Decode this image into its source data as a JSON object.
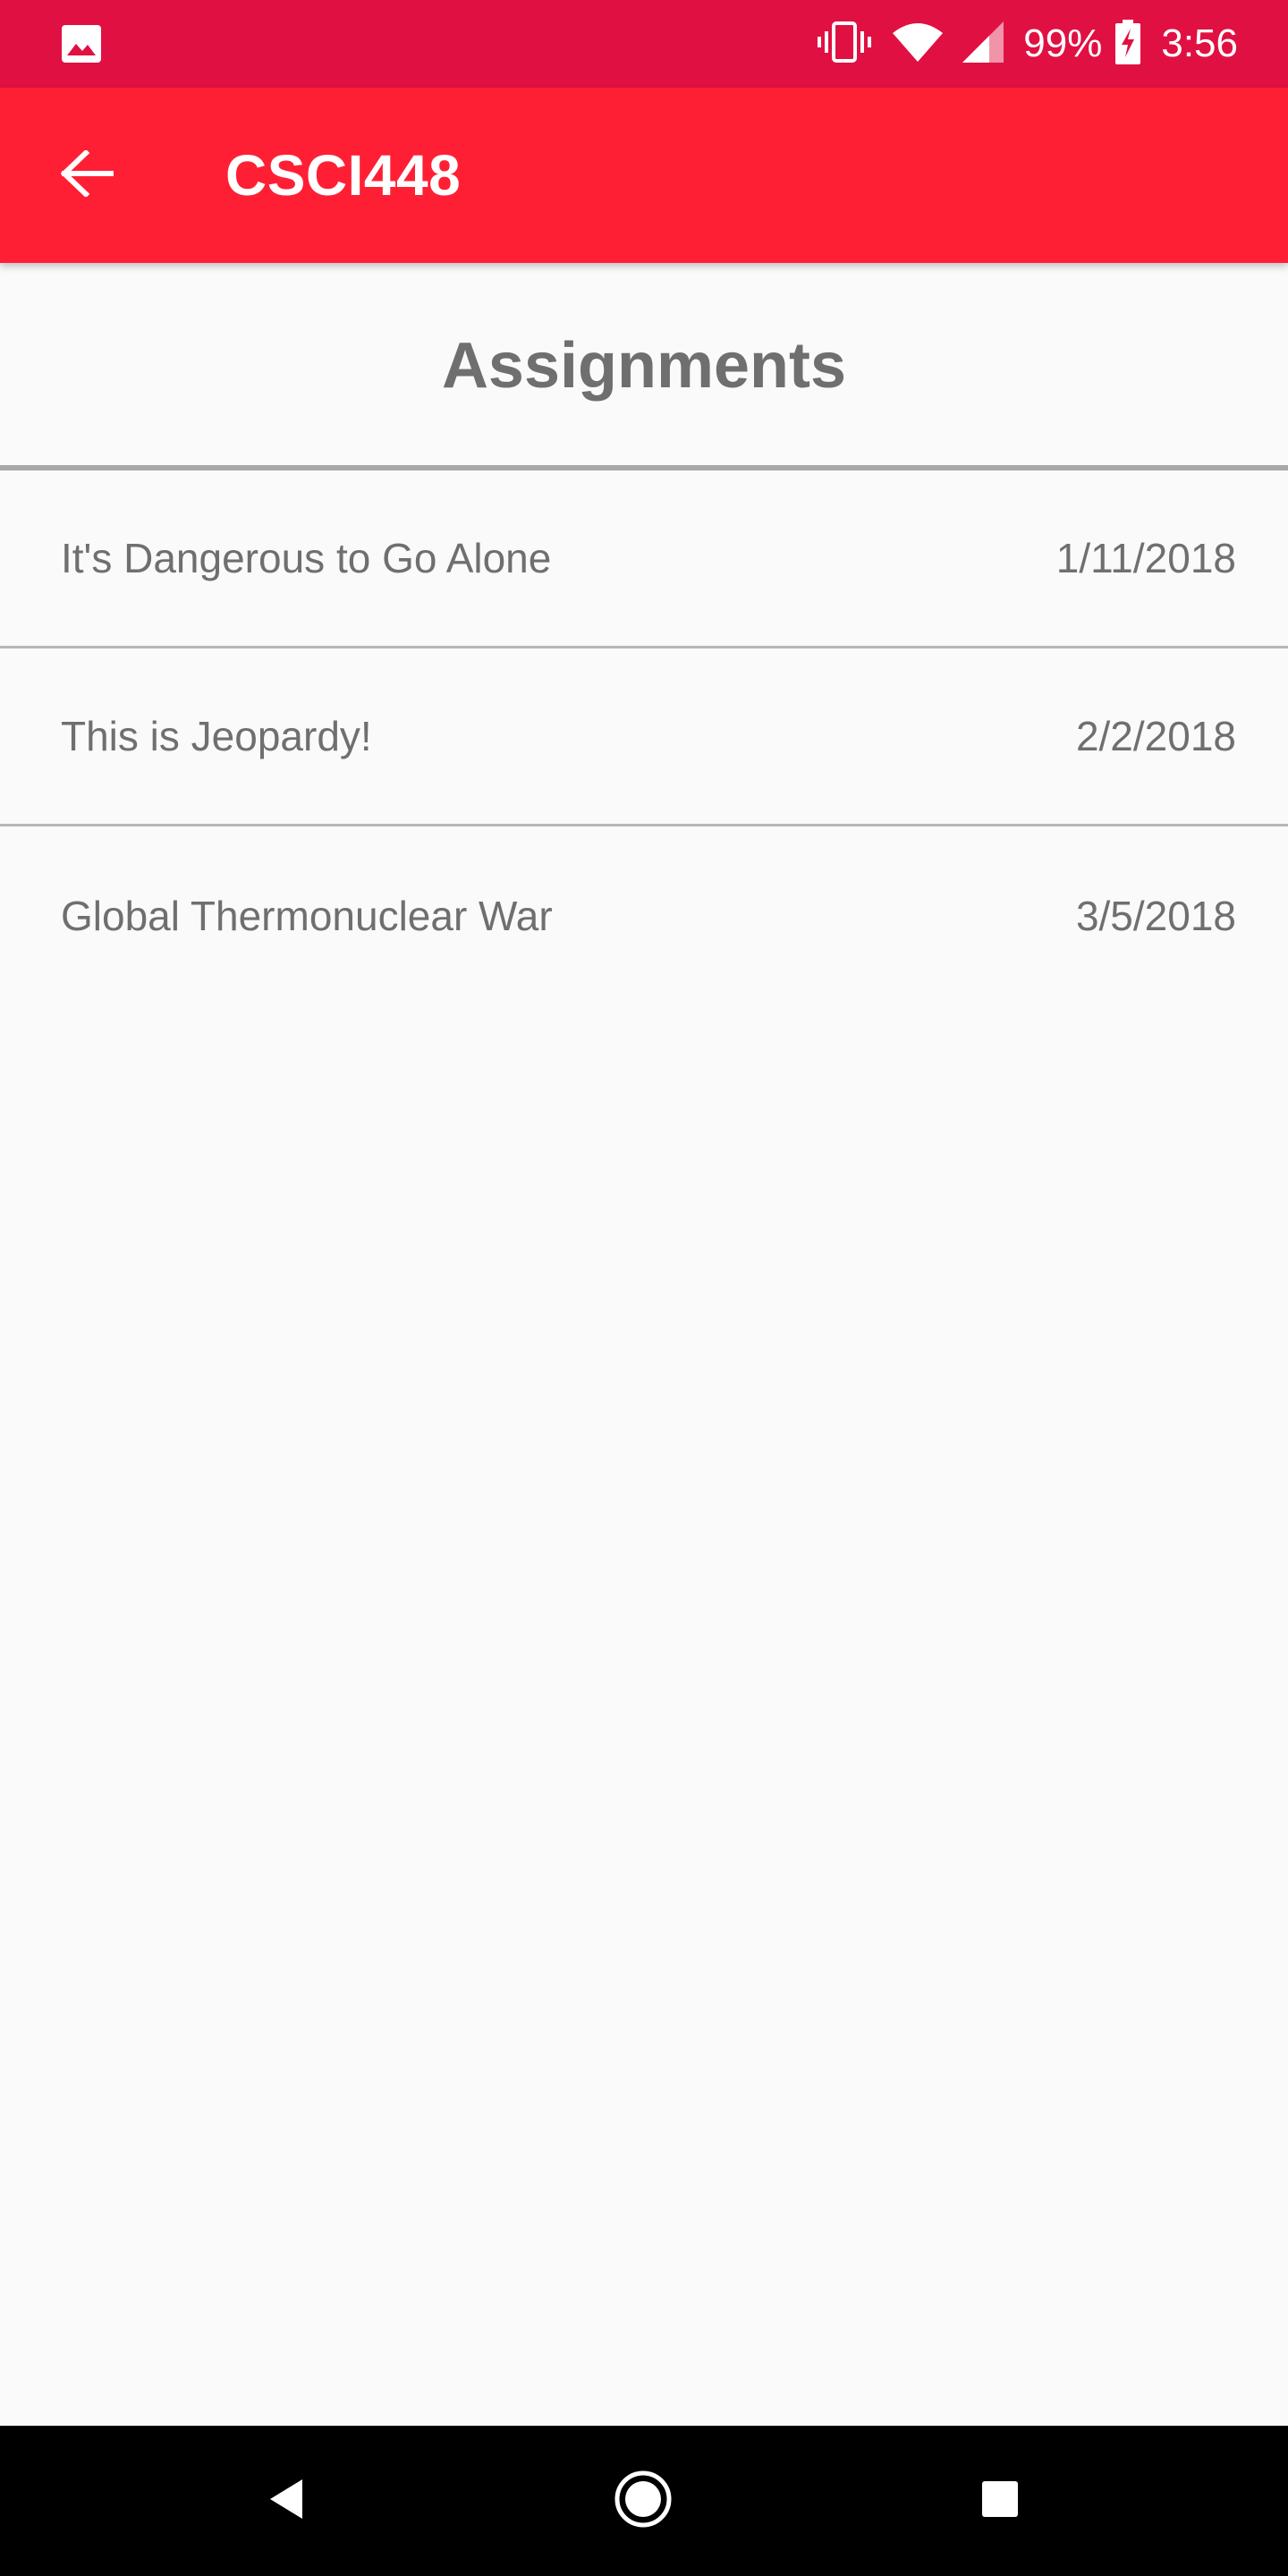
{
  "status_bar": {
    "left_icon": "image-icon",
    "icons": [
      "vibrate-icon",
      "wifi-icon",
      "cellular-signal-icon"
    ],
    "battery_percent": "99%",
    "battery_icon": "battery-charging-icon",
    "time": "3:56"
  },
  "app_bar": {
    "back_icon": "arrow-back-icon",
    "title": "CSCI448"
  },
  "page": {
    "heading": "Assignments"
  },
  "assignments": [
    {
      "title": "It's Dangerous to Go Alone",
      "date": "1/11/2018"
    },
    {
      "title": "This is Jeopardy!",
      "date": "2/2/2018"
    },
    {
      "title": "Global Thermonuclear War",
      "date": "3/5/2018"
    }
  ],
  "nav_bar": {
    "back": "nav-back-icon",
    "home": "nav-home-icon",
    "recents": "nav-recents-icon"
  },
  "colors": {
    "status_bar": "#e01142",
    "app_bar": "#ff1f34",
    "text": "#6f6f6f",
    "background": "#fafafa"
  }
}
